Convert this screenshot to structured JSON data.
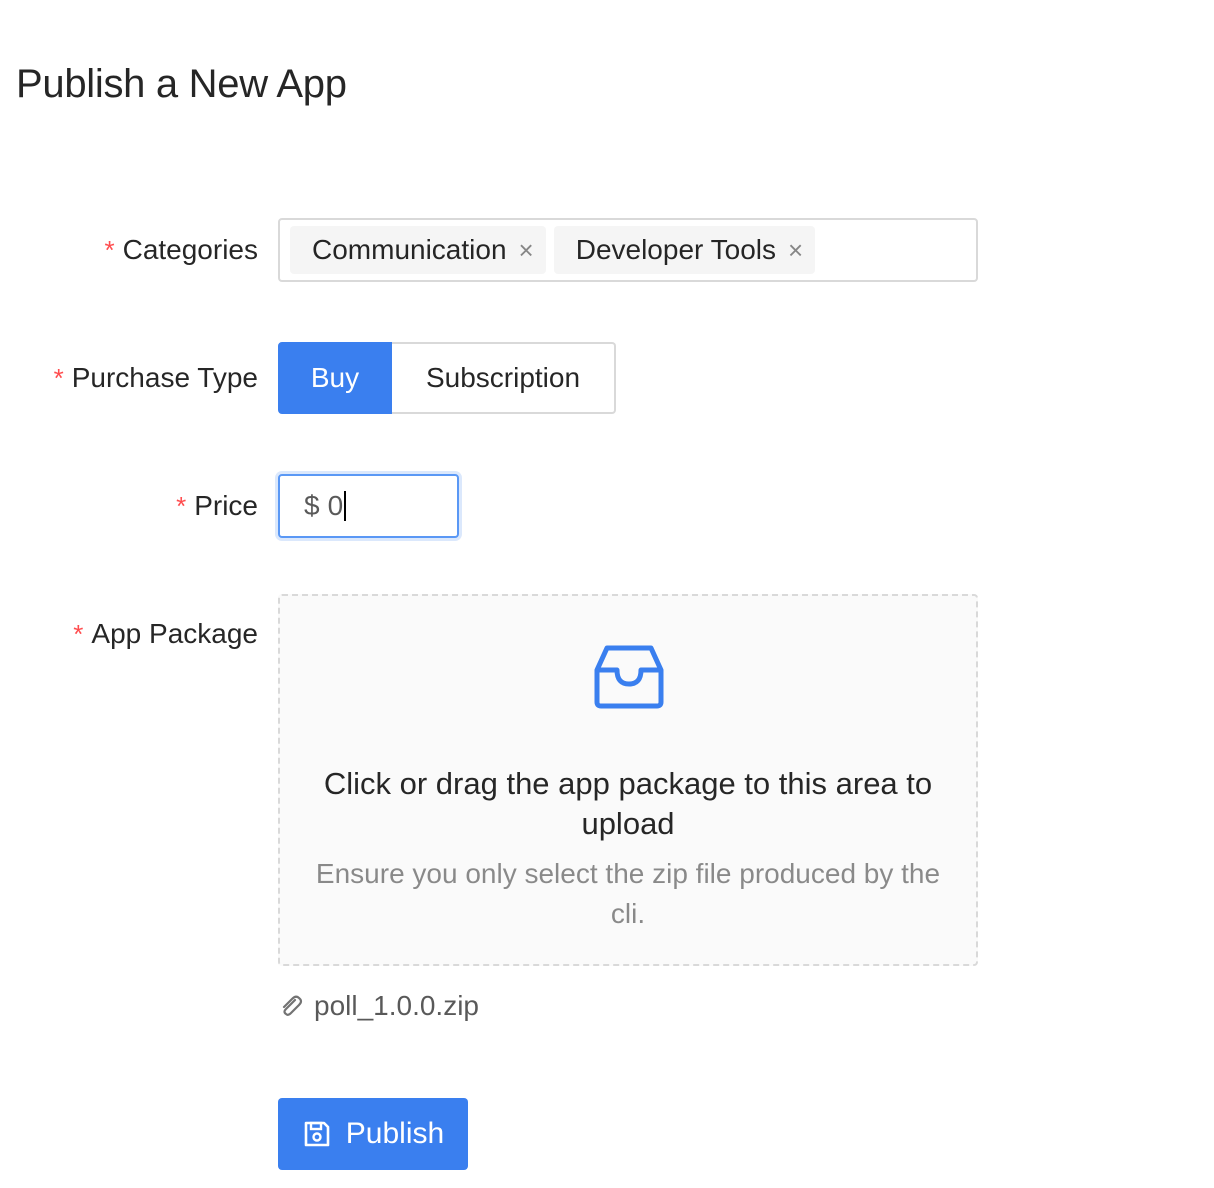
{
  "page": {
    "title": "Publish a New App"
  },
  "form": {
    "categories": {
      "label": "Categories",
      "required_mark": "*",
      "tags": [
        {
          "label": "Communication",
          "close": "×"
        },
        {
          "label": "Developer Tools",
          "close": "×"
        }
      ]
    },
    "purchase_type": {
      "label": "Purchase Type",
      "required_mark": "*",
      "options": [
        "Buy",
        "Subscription"
      ],
      "selected": "Buy"
    },
    "price": {
      "label": "Price",
      "required_mark": "*",
      "prefix": "$",
      "value": "0"
    },
    "app_package": {
      "label": "App Package",
      "required_mark": "*",
      "drag_text": "Click or drag the app package to this area to upload",
      "hint": "Ensure you only select the zip file produced by the cli.",
      "icon": "inbox-icon",
      "files": [
        {
          "name": "poll_1.0.0.zip",
          "icon": "paperclip-icon"
        }
      ]
    },
    "submit": {
      "label": "Publish",
      "icon": "save-icon"
    }
  },
  "colors": {
    "primary": "#3a7fef",
    "required": "#ff4d4f",
    "border": "#d9d9d9"
  }
}
